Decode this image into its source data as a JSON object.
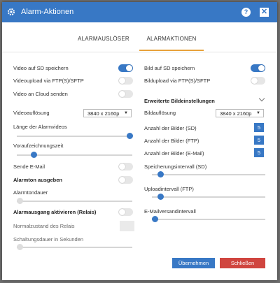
{
  "window": {
    "title": "Alarm-Aktionen",
    "help_label": "?",
    "close_label": "✕"
  },
  "tabs": [
    {
      "label": "ALARMAUSLÖSER",
      "active": false
    },
    {
      "label": "ALARMAKTIONEN",
      "active": true
    }
  ],
  "left": {
    "video_sd": {
      "label": "Video auf SD speichern",
      "on": true
    },
    "video_ftp": {
      "label": "Videoupload via FTP(S)/SFTP",
      "on": false
    },
    "video_cloud": {
      "label": "Video an Cloud senden",
      "on": false
    },
    "video_resolution": {
      "label": "Videoauflösung",
      "value": "3840 x 2160p"
    },
    "alarm_video_length": {
      "label": "Länge der Alarmvideos",
      "level": 1.0
    },
    "pre_record": {
      "label": "Voraufzeichnungszeit",
      "level": 0.2
    },
    "send_email": {
      "label": "Sende E-Mail",
      "on": false
    },
    "alarm_tone": {
      "label": "Alarmton ausgeben",
      "on": false
    },
    "alarm_tone_duration": {
      "label": "Alarmtondauer",
      "level": 0.0
    },
    "relay": {
      "label": "Alarmausgang aktivieren (Relais)",
      "on": false
    },
    "relay_normal": {
      "label": "Normalzustand des Relais"
    },
    "relay_duration": {
      "label": "Schaltungsdauer in Sekunden",
      "level": 0.0
    }
  },
  "right": {
    "image_sd": {
      "label": "Bild auf SD speichern",
      "on": true
    },
    "image_ftp": {
      "label": "Bildupload via FTP(S)/SFTP",
      "on": false
    },
    "advanced_title": "Erweiterte Bildeinstellungen",
    "image_resolution": {
      "label": "Bildauflösung",
      "value": "3840 x 2160p"
    },
    "count_sd": {
      "label": "Anzahl der Bilder (SD)",
      "value": "5"
    },
    "count_ftp": {
      "label": "Anzahl der Bilder (FTP)",
      "value": "5"
    },
    "count_email": {
      "label": "Anzahl der Bilder (E-Mail)",
      "value": "5"
    },
    "storage_interval": {
      "label": "Speicherungsintervall (SD)",
      "level": 0.1
    },
    "upload_interval": {
      "label": "Uploadintervall (FTP)",
      "level": 0.1
    },
    "email_interval": {
      "label": "E-Mailversandintervall",
      "level": 0.04
    }
  },
  "buttons": {
    "apply": "Übernehmen",
    "close": "Schließen"
  },
  "colors": {
    "accent": "#3878c5",
    "tab_underline": "#e8a13a",
    "danger": "#d0453f"
  }
}
